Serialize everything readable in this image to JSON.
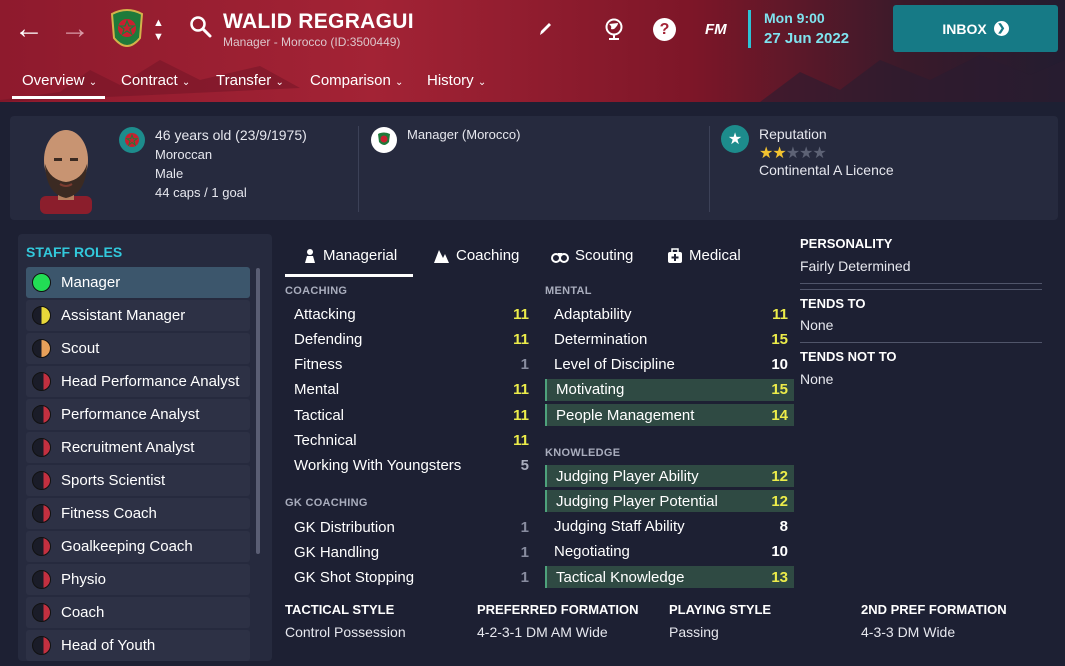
{
  "nav": {
    "back_icon": "back-arrow-icon",
    "forward_icon": "forward-arrow-icon"
  },
  "person": {
    "name": "WALID REGRAGUI",
    "subtitle": "Manager - Morocco (ID:3500449)"
  },
  "datetime": {
    "time": "Mon 9:00",
    "date": "27 Jun 2022"
  },
  "topicons": [
    "pencil-icon",
    "globe-icon",
    "help-icon",
    "fm-logo"
  ],
  "fm_label": "FM",
  "inbox": {
    "label": "INBOX"
  },
  "tabs": [
    {
      "label": "Overview"
    },
    {
      "label": "Contract"
    },
    {
      "label": "Transfer"
    },
    {
      "label": "Comparison"
    },
    {
      "label": "History"
    }
  ],
  "info": {
    "age": "46 years old (23/9/1975)",
    "nationality": "Moroccan",
    "gender": "Male",
    "caps": "44 caps / 1 goal",
    "role": "Manager (Morocco)",
    "reputation_label": "Reputation",
    "reputation_stars": 2,
    "reputation_max": 5,
    "licence": "Continental A Licence"
  },
  "staff_roles": {
    "title": "STAFF ROLES",
    "items": [
      {
        "label": "Manager",
        "dot": "#22dd55",
        "style": "full"
      },
      {
        "label": "Assistant Manager",
        "dot": "#e8d83a",
        "style": "half"
      },
      {
        "label": "Scout",
        "dot": "#e8a05a",
        "style": "half"
      },
      {
        "label": "Head Performance Analyst",
        "dot": "#c33040",
        "style": "thin"
      },
      {
        "label": "Performance Analyst",
        "dot": "#c33040",
        "style": "thin"
      },
      {
        "label": "Recruitment Analyst",
        "dot": "#c33040",
        "style": "thin"
      },
      {
        "label": "Sports Scientist",
        "dot": "#c33040",
        "style": "thin"
      },
      {
        "label": "Fitness Coach",
        "dot": "#c33040",
        "style": "thin"
      },
      {
        "label": "Goalkeeping Coach",
        "dot": "#c33040",
        "style": "thin"
      },
      {
        "label": "Physio",
        "dot": "#c33040",
        "style": "thin"
      },
      {
        "label": "Coach",
        "dot": "#c33040",
        "style": "thin"
      },
      {
        "label": "Head of Youth",
        "dot": "#c33040",
        "style": "thin"
      }
    ]
  },
  "subtabs": [
    {
      "label": "Managerial",
      "icon": "managerial-icon"
    },
    {
      "label": "Coaching",
      "icon": "coaching-icon"
    },
    {
      "label": "Scouting",
      "icon": "binoculars-icon"
    },
    {
      "label": "Medical",
      "icon": "medical-icon"
    }
  ],
  "coaching": {
    "title": "COACHING",
    "items": [
      {
        "name": "Attacking",
        "value": "11"
      },
      {
        "name": "Defending",
        "value": "11"
      },
      {
        "name": "Fitness",
        "value": "1"
      },
      {
        "name": "Mental",
        "value": "11"
      },
      {
        "name": "Tactical",
        "value": "11"
      },
      {
        "name": "Technical",
        "value": "11"
      },
      {
        "name": "Working With Youngsters",
        "value": "5"
      }
    ]
  },
  "gk_coaching": {
    "title": "GK COACHING",
    "items": [
      {
        "name": "GK Distribution",
        "value": "1"
      },
      {
        "name": "GK Handling",
        "value": "1"
      },
      {
        "name": "GK Shot Stopping",
        "value": "1"
      }
    ]
  },
  "mental": {
    "title": "MENTAL",
    "items": [
      {
        "name": "Adaptability",
        "value": "11",
        "hl": false
      },
      {
        "name": "Determination",
        "value": "15",
        "hl": false
      },
      {
        "name": "Level of Discipline",
        "value": "10",
        "hl": false
      },
      {
        "name": "Motivating",
        "value": "15",
        "hl": true
      },
      {
        "name": "People Management",
        "value": "14",
        "hl": true
      }
    ]
  },
  "knowledge": {
    "title": "KNOWLEDGE",
    "items": [
      {
        "name": "Judging Player Ability",
        "value": "12",
        "hl": true
      },
      {
        "name": "Judging Player Potential",
        "value": "12",
        "hl": true
      },
      {
        "name": "Judging Staff Ability",
        "value": "8",
        "hl": false
      },
      {
        "name": "Negotiating",
        "value": "10",
        "hl": false
      },
      {
        "name": "Tactical Knowledge",
        "value": "13",
        "hl": true
      }
    ]
  },
  "personality": {
    "title": "PERSONALITY",
    "value": "Fairly Determined",
    "tends_to_title": "TENDS TO",
    "tends_to": "None",
    "tends_not_to_title": "TENDS NOT TO",
    "tends_not_to": "None"
  },
  "bottom": {
    "tactical_style_title": "TACTICAL STYLE",
    "tactical_style": "Control Possession",
    "preferred_formation_title": "PREFERRED FORMATION",
    "preferred_formation": "4-2-3-1 DM AM Wide",
    "playing_style_title": "PLAYING STYLE",
    "playing_style": "Passing",
    "second_formation_title": "2ND PREF FORMATION",
    "second_formation": "4-3-3 DM Wide"
  },
  "colors": {
    "accent": "#32c9dc",
    "header": "#a32335",
    "value_yellow": "#ecec4a",
    "highlight": "#2f4a43"
  }
}
